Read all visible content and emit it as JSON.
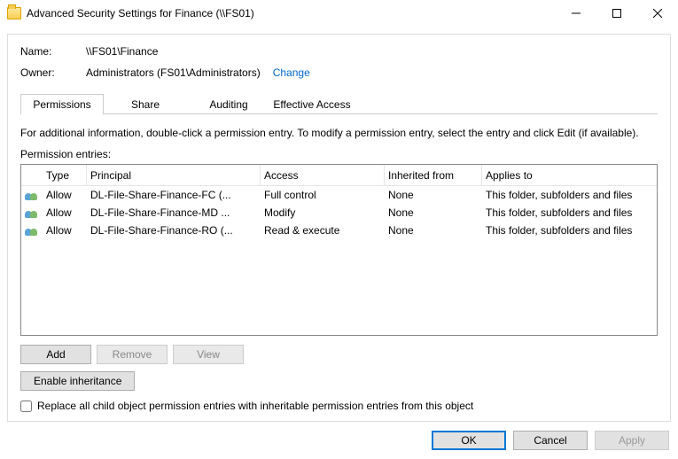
{
  "window": {
    "title": "Advanced Security Settings for Finance (\\\\FS01)"
  },
  "fields": {
    "name_label": "Name:",
    "name_value": "\\\\FS01\\Finance",
    "owner_label": "Owner:",
    "owner_value": "Administrators (FS01\\Administrators)",
    "change_link": "Change"
  },
  "tabs": {
    "permissions": "Permissions",
    "share": "Share",
    "auditing": "Auditing",
    "effective": "Effective Access"
  },
  "info_text": "For additional information, double-click a permission entry. To modify a permission entry, select the entry and click Edit (if available).",
  "entries_label": "Permission entries:",
  "columns": {
    "type": "Type",
    "principal": "Principal",
    "access": "Access",
    "inherited": "Inherited from",
    "applies": "Applies to"
  },
  "rows": [
    {
      "type": "Allow",
      "principal": "DL-File-Share-Finance-FC (...",
      "access": "Full control",
      "inherited": "None",
      "applies": "This folder, subfolders and files"
    },
    {
      "type": "Allow",
      "principal": "DL-File-Share-Finance-MD ...",
      "access": "Modify",
      "inherited": "None",
      "applies": "This folder, subfolders and files"
    },
    {
      "type": "Allow",
      "principal": "DL-File-Share-Finance-RO (...",
      "access": "Read & execute",
      "inherited": "None",
      "applies": "This folder, subfolders and files"
    }
  ],
  "buttons": {
    "add": "Add",
    "remove": "Remove",
    "view": "View",
    "enable_inheritance": "Enable inheritance",
    "replace_checkbox": "Replace all child object permission entries with inheritable permission entries from this object",
    "ok": "OK",
    "cancel": "Cancel",
    "apply": "Apply"
  }
}
